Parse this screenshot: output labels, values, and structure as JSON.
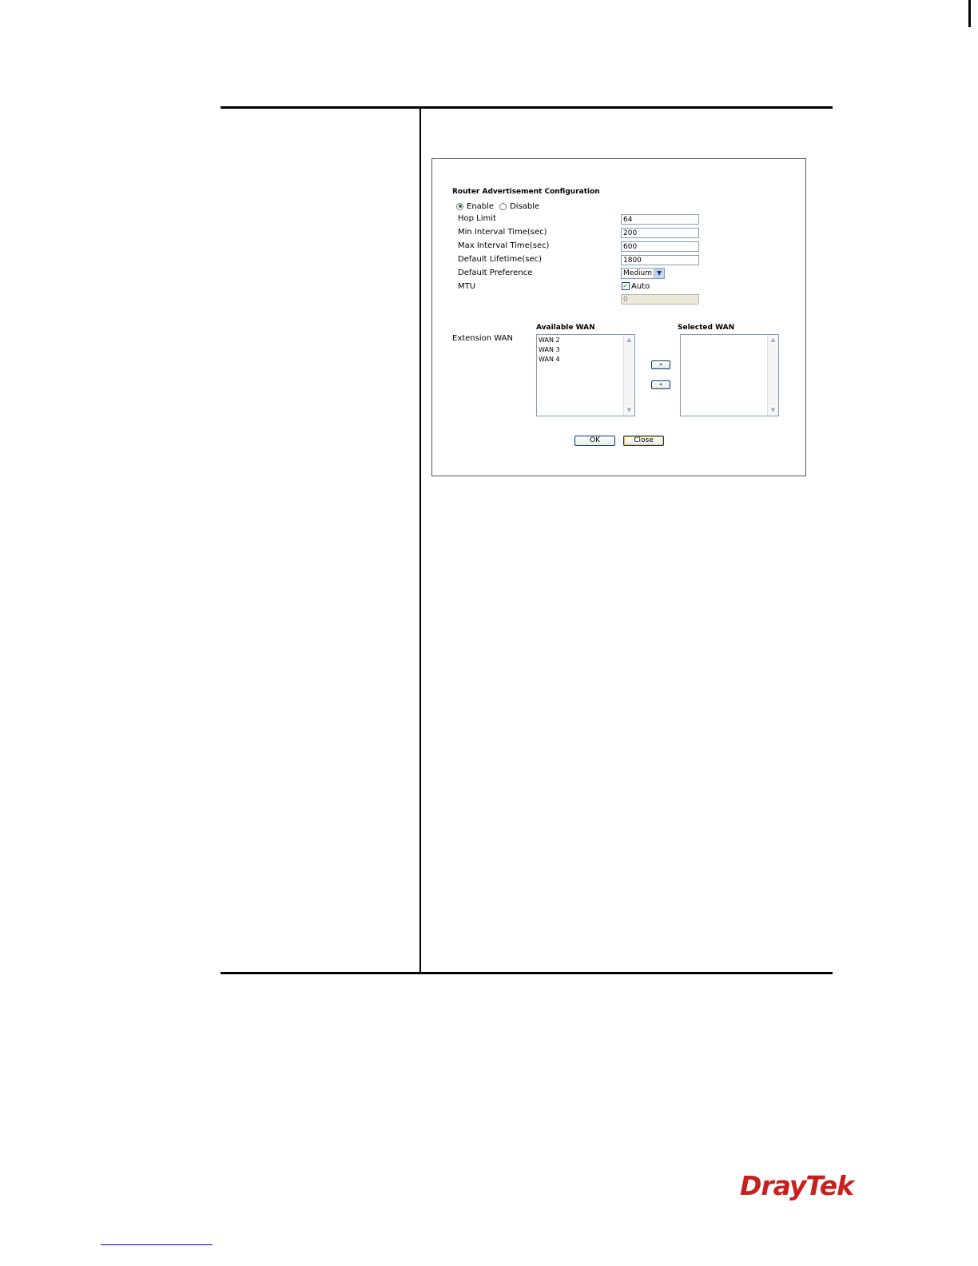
{
  "dialog": {
    "section_title": "Router Advertisement Configuration",
    "status": {
      "enable_label": "Enable",
      "disable_label": "Disable",
      "selected": "Enable"
    },
    "fields": {
      "hop_limit": {
        "label": "Hop Limit",
        "value": "64"
      },
      "min_interval": {
        "label": "Min Interval Time(sec)",
        "value": "200"
      },
      "max_interval": {
        "label": "Max Interval Time(sec)",
        "value": "600"
      },
      "default_lifetime": {
        "label": "Default Lifetime(sec)",
        "value": "1800"
      },
      "default_preference": {
        "label": "Default Preference",
        "value": "Medium"
      },
      "mtu": {
        "label": "MTU",
        "auto_label": "Auto",
        "auto_checked": true,
        "value": "0"
      }
    },
    "extension_wan": {
      "label": "Extension WAN",
      "available_header": "Available WAN",
      "selected_header": "Selected WAN",
      "available_items": [
        "WAN 2",
        "WAN 3",
        "WAN 4"
      ],
      "selected_items": [],
      "add_label": "»",
      "remove_label": "«"
    },
    "buttons": {
      "ok_label": "OK",
      "close_label": "Close"
    }
  },
  "brand": {
    "logo_text": "DrayTek",
    "logo_color": "#c8201f"
  }
}
